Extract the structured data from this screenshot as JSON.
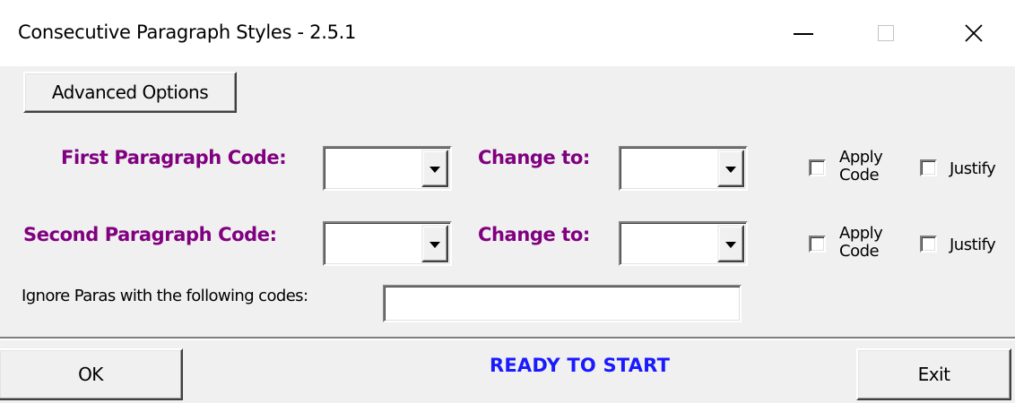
{
  "window": {
    "title": "Consecutive Paragraph Styles - 2.5.1"
  },
  "toolbar": {
    "advanced_options_label": "Advanced Options"
  },
  "rows": [
    {
      "code_label": "First Paragraph Code:",
      "code_value": "",
      "change_to_label": "Change to:",
      "change_to_value": "",
      "apply_code_label_line1": "Apply",
      "apply_code_label_line2": "Code",
      "apply_code_checked": false,
      "justify_label": "Justify",
      "justify_checked": false
    },
    {
      "code_label": "Second Paragraph Code:",
      "code_value": "",
      "change_to_label": "Change to:",
      "change_to_value": "",
      "apply_code_label_line1": "Apply",
      "apply_code_label_line2": "Code",
      "apply_code_checked": false,
      "justify_label": "Justify",
      "justify_checked": false
    }
  ],
  "ignore": {
    "label": "Ignore Paras with the following codes:",
    "value": ""
  },
  "footer": {
    "ok_label": "OK",
    "status": "READY TO START",
    "exit_label": "Exit"
  },
  "colors": {
    "label_purple": "#800080",
    "status_blue": "#1a1aff",
    "face": "#f0f0f0"
  }
}
